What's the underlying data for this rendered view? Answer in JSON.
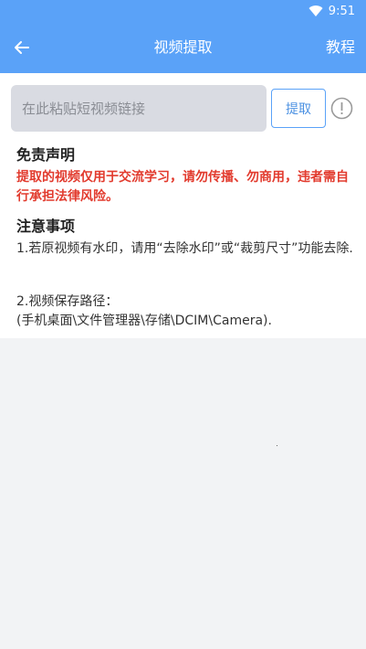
{
  "status_bar": {
    "time": "9:51"
  },
  "toolbar": {
    "title": "视频提取",
    "tutorial_label": "教程"
  },
  "input": {
    "value": "",
    "placeholder": "在此粘贴短视频链接"
  },
  "extract_button": {
    "label": "提取"
  },
  "disclaimer": {
    "heading": "免责声明",
    "text": "提取的视频仅用于交流学习，请勿传播、勿商用，违者需自行承担法律风险。"
  },
  "notes": {
    "heading": "注意事项",
    "item1": "1.若原视频有水印，请用“去除水印”或“裁剪尺寸”功能去除.",
    "item2_line1": "2.视频保存路径：",
    "item2_line2": "(手机桌面\\文件管理器\\存储\\DCIM\\Camera)."
  },
  "colors": {
    "appbar": "#5aa2f8",
    "warning": "#e23b2e",
    "input_bg": "#d9dbe2"
  },
  "icons": {
    "back": "arrow-left-icon",
    "wifi": "wifi-icon",
    "info": "info-icon"
  }
}
